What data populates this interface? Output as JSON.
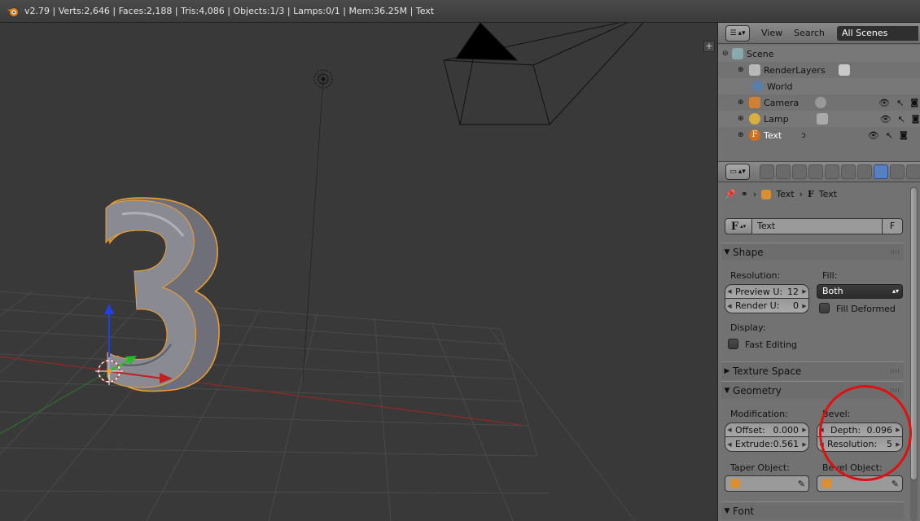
{
  "header": {
    "status": "v2.79 | Verts:2,646 | Faces:2,188 | Tris:4,086 | Objects:1/3 | Lamps:0/1 | Mem:36.25M | Text"
  },
  "outliner": {
    "menu_view": "View",
    "menu_search": "Search",
    "scene_filter": "All Scenes",
    "items": [
      {
        "label": "Scene",
        "icon": "scene-icon"
      },
      {
        "label": "RenderLayers",
        "icon": "renderlayers-icon"
      },
      {
        "label": "World",
        "icon": "world-icon"
      },
      {
        "label": "Camera",
        "icon": "camera-icon"
      },
      {
        "label": "Lamp",
        "icon": "lamp-icon"
      },
      {
        "label": "Text",
        "icon": "font-icon"
      }
    ]
  },
  "properties": {
    "breadcrumb": {
      "object": "Text",
      "data": "Text"
    },
    "datablock": {
      "type_glyph": "F",
      "name": "Text",
      "fake_user": "F"
    },
    "shape": {
      "title": "Shape",
      "resolution_label": "Resolution:",
      "preview_u_label": "Preview U:",
      "preview_u_value": "12",
      "render_u_label": "Render U:",
      "render_u_value": "0",
      "fill_label": "Fill:",
      "fill_value": "Both",
      "fill_deformed_label": "Fill Deformed",
      "display_label": "Display:",
      "fast_editing_label": "Fast Editing"
    },
    "texture_space": {
      "title": "Texture Space"
    },
    "geometry": {
      "title": "Geometry",
      "modification_label": "Modification:",
      "offset_label": "Offset:",
      "offset_value": "0.000",
      "extrude_label": "Extrude:",
      "extrude_value": "0.561",
      "bevel_label": "Bevel:",
      "depth_label": "Depth:",
      "depth_value": "0.096",
      "resolution_label": "Resolution:",
      "resolution_value": "5",
      "taper_object_label": "Taper Object:",
      "bevel_object_label": "Bevel Object:"
    },
    "font": {
      "title": "Font"
    }
  },
  "viewport": {
    "object_text": "3"
  },
  "colors": {
    "viewport_bg": "#393939",
    "selection_outline": "#f0a030",
    "highlight_circle": "#e01010",
    "x_axis": "#c02020",
    "y_axis": "#20c020",
    "z_axis": "#2040e0"
  }
}
